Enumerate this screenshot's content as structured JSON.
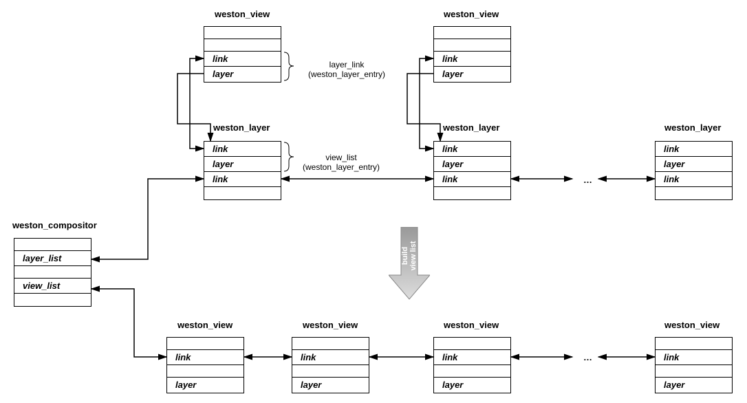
{
  "labels": {
    "weston_compositor": "weston_compositor",
    "weston_view": "weston_view",
    "weston_layer": "weston_layer",
    "link": "link",
    "layer": "layer",
    "layer_list": "layer_list",
    "view_list": "view_list",
    "ellipsis": "…",
    "build_view_list": "build\nview list",
    "layer_link_note": "layer_link\n(weston_layer_entry)",
    "view_list_note": "view_list\n(weston_layer_entry)"
  },
  "chart_data": {
    "type": "diagram",
    "nodes": [
      {
        "id": "compositor",
        "type": "weston_compositor",
        "fields": [
          "layer_list",
          "view_list"
        ]
      },
      {
        "id": "view_top_1",
        "type": "weston_view",
        "fields": [
          "link",
          "layer"
        ]
      },
      {
        "id": "view_top_2",
        "type": "weston_view",
        "fields": [
          "link",
          "layer"
        ]
      },
      {
        "id": "layer_1",
        "type": "weston_layer",
        "fields": [
          "link",
          "layer",
          "link"
        ]
      },
      {
        "id": "layer_2",
        "type": "weston_layer",
        "fields": [
          "link",
          "layer",
          "link"
        ]
      },
      {
        "id": "layer_n",
        "type": "weston_layer",
        "fields": [
          "link",
          "layer",
          "link"
        ]
      },
      {
        "id": "view_b_1",
        "type": "weston_view",
        "fields": [
          "link",
          "layer"
        ]
      },
      {
        "id": "view_b_2",
        "type": "weston_view",
        "fields": [
          "link",
          "layer"
        ]
      },
      {
        "id": "view_b_3",
        "type": "weston_view",
        "fields": [
          "link",
          "layer"
        ]
      },
      {
        "id": "view_b_n",
        "type": "weston_view",
        "fields": [
          "link",
          "layer"
        ]
      }
    ],
    "edges": [
      {
        "from": "compositor.layer_list",
        "to": "layer_1.link_bottom",
        "kind": "bidir"
      },
      {
        "from": "compositor.view_list",
        "to": "view_b_1.link",
        "kind": "bidir"
      },
      {
        "from": "layer_1.link_bottom",
        "to": "layer_2.link_bottom",
        "kind": "bidir"
      },
      {
        "from": "layer_2.link_bottom",
        "to": "layer_n.link_bottom",
        "kind": "bidir_ellipsis"
      },
      {
        "from": "layer_1.link_top",
        "to": "view_top_1.link",
        "kind": "bidir"
      },
      {
        "from": "view_top_1.layer",
        "to": "layer_1",
        "kind": "pointer"
      },
      {
        "from": "layer_2.link_top",
        "to": "view_top_2.link",
        "kind": "bidir"
      },
      {
        "from": "view_top_2.layer",
        "to": "layer_2",
        "kind": "pointer"
      },
      {
        "from": "view_b_1.link",
        "to": "view_b_2.link",
        "kind": "bidir"
      },
      {
        "from": "view_b_2.link",
        "to": "view_b_3.link",
        "kind": "bidir"
      },
      {
        "from": "view_b_3.link",
        "to": "view_b_n.link",
        "kind": "bidir_ellipsis"
      }
    ],
    "annotations": [
      {
        "target": "view_top_1",
        "brace": [
          "link",
          "layer"
        ],
        "text": "layer_link (weston_layer_entry)"
      },
      {
        "target": "layer_1",
        "brace": [
          "link",
          "layer"
        ],
        "text": "view_list (weston_layer_entry)"
      }
    ],
    "transform_arrow": {
      "label": "build view list",
      "from": "layer_chain",
      "to": "view_list_chain"
    }
  }
}
